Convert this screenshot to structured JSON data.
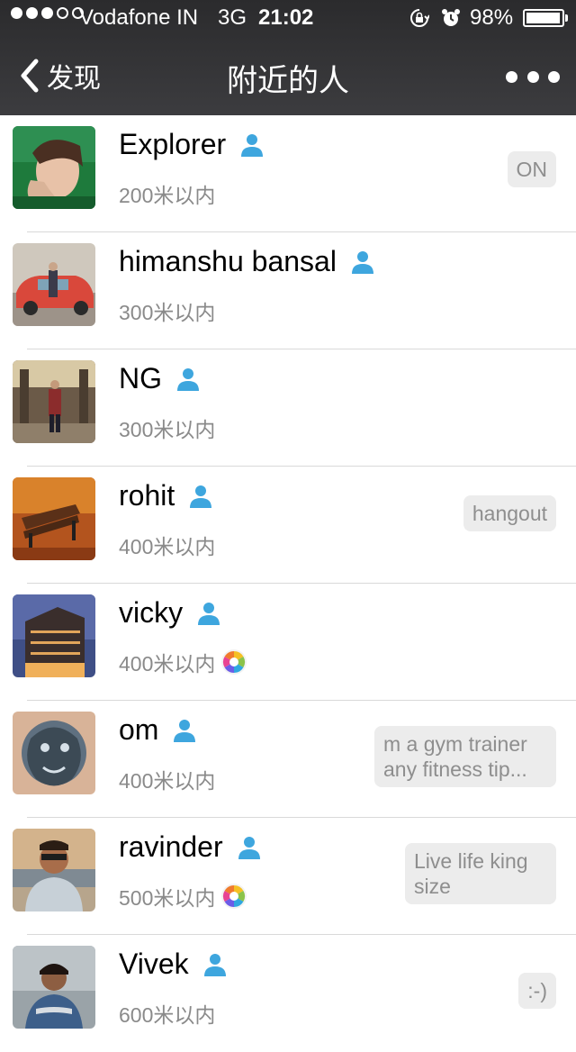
{
  "status_bar": {
    "carrier": "Vodafone IN",
    "network": "3G",
    "time": "21:02",
    "battery_percent": "98%",
    "battery_level": 0.98,
    "signal_bars_filled": 3,
    "signal_bars_total": 5
  },
  "nav": {
    "back_label": "发现",
    "title": "附近的人"
  },
  "colors": {
    "header_bg": "#333335",
    "accent_person_icon": "#3ea6de",
    "signature_bg": "#ececec",
    "distance_text": "#8a8a8a"
  },
  "people": [
    {
      "name": "Explorer",
      "distance": "200米以内",
      "signature": "ON",
      "moments": false
    },
    {
      "name": "himanshu bansal",
      "distance": "300米以内",
      "signature": "",
      "moments": false
    },
    {
      "name": "NG",
      "distance": "300米以内",
      "signature": "",
      "moments": false
    },
    {
      "name": "rohit",
      "distance": "400米以内",
      "signature": "hangout",
      "moments": false
    },
    {
      "name": "vicky",
      "distance": "400米以内",
      "signature": "",
      "moments": true
    },
    {
      "name": "om",
      "distance": "400米以内",
      "signature": "m a gym trainer any fitness tip...",
      "moments": false
    },
    {
      "name": "ravinder",
      "distance": "500米以内",
      "signature": "Live life king size",
      "moments": true
    },
    {
      "name": "Vivek",
      "distance": "600米以内",
      "signature": ":-)",
      "moments": false
    }
  ]
}
